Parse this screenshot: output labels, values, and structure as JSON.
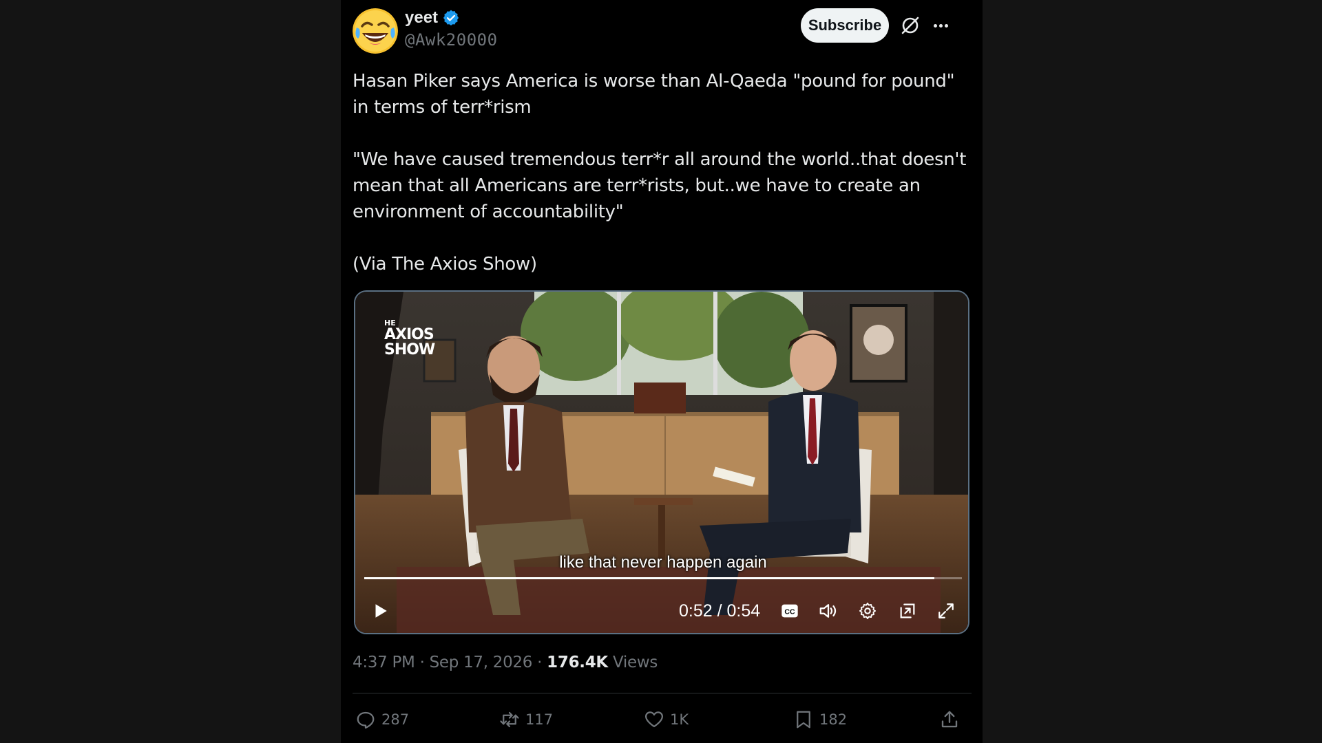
{
  "post": {
    "author": {
      "display_name": "yeet",
      "handle": "@Awk20000",
      "verified": true,
      "avatar_icon": "face-with-tears-of-joy-emoji"
    },
    "subscribe_label": "Subscribe",
    "text_paragraphs": [
      "Hasan Piker says America is worse than Al-Qaeda \"pound for pound\" in terms of terr*rism",
      "",
      "\"We have caused tremendous terr*r all around the world..that doesn't mean that all Americans are terr*rists, but..we have to create an environment of accountability\"",
      "",
      "(Via The Axios Show)"
    ],
    "video": {
      "brand_logo_lines": [
        "HE",
        "AXIOS",
        "SHOW"
      ],
      "caption": "like that never happen again",
      "current_time": "0:52",
      "duration": "0:54",
      "time_display": "0:52 / 0:54",
      "progress_fraction": 0.954
    },
    "meta": {
      "time": "4:37 PM",
      "date": "Sep 17, 2026",
      "separator": " · ",
      "views_count": "176.4K",
      "views_label": "Views"
    },
    "actions": {
      "replies": "287",
      "reposts": "117",
      "likes": "1K",
      "bookmarks": "182"
    }
  },
  "colors": {
    "background": "#000000",
    "page_side": "#141414",
    "text_primary": "#e7e9ea",
    "text_secondary": "#71767b",
    "verified_blue": "#1d9bf0",
    "subscribe_bg": "#eff3f4"
  }
}
